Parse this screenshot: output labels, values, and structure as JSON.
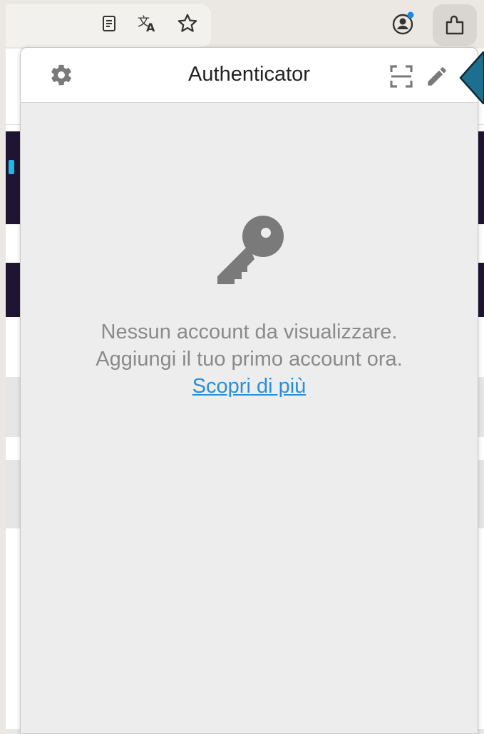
{
  "browser": {
    "toolbar_icons": [
      "reader-mode-icon",
      "translate-icon",
      "bookmark-star-icon",
      "account-icon",
      "extensions-icon"
    ]
  },
  "popup": {
    "title": "Authenticator",
    "header_icons": [
      "settings-icon",
      "scan-qr-icon",
      "edit-icon"
    ],
    "empty_state": {
      "icon": "key-icon",
      "line1": "Nessun account da visualizzare.",
      "line2": "Aggiungi il tuo primo account ora.",
      "link": "Scopri di più"
    }
  },
  "colors": {
    "header_bg": "#ffffff",
    "body_bg": "#ededed",
    "text_muted": "#8a8a8a",
    "link": "#2a8fd8",
    "icon_gray": "#7a7a7a",
    "page_dark_band": "#1f1533",
    "tooltip_arrow": "#1c6f8f"
  }
}
